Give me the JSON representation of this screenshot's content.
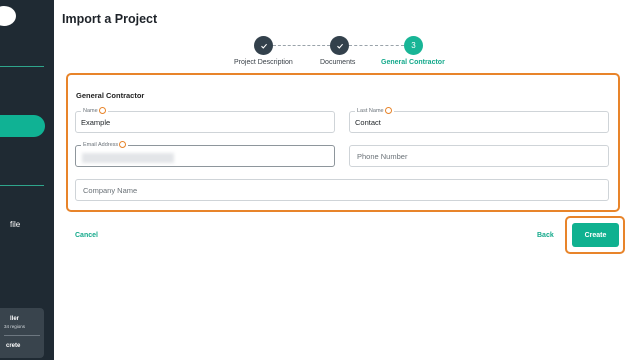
{
  "sidebar": {
    "item_label": "file",
    "card": {
      "title": "ller",
      "subtitle": "34 regions",
      "bottom": "crete"
    }
  },
  "page": {
    "title": "Import a Project"
  },
  "stepper": {
    "steps": [
      {
        "label": "Project Description",
        "state": "done",
        "icon": "check-icon"
      },
      {
        "label": "Documents",
        "state": "done",
        "icon": "check-icon"
      },
      {
        "label": "General Contractor",
        "state": "active",
        "number": "3"
      }
    ]
  },
  "form": {
    "section_title": "General Contractor",
    "name": {
      "label": "Name",
      "value": "Example"
    },
    "last_name": {
      "label": "Last Name",
      "value": "Contact"
    },
    "email": {
      "label": "Email Address",
      "value": ""
    },
    "phone": {
      "placeholder": "Phone Number"
    },
    "company": {
      "placeholder": "Company Name"
    }
  },
  "actions": {
    "cancel": "Cancel",
    "back": "Back",
    "create": "Create"
  },
  "colors": {
    "accent": "#0fb190",
    "highlight": "#e8842a",
    "sidebar": "#1f2a33",
    "step_done": "#33414c"
  }
}
